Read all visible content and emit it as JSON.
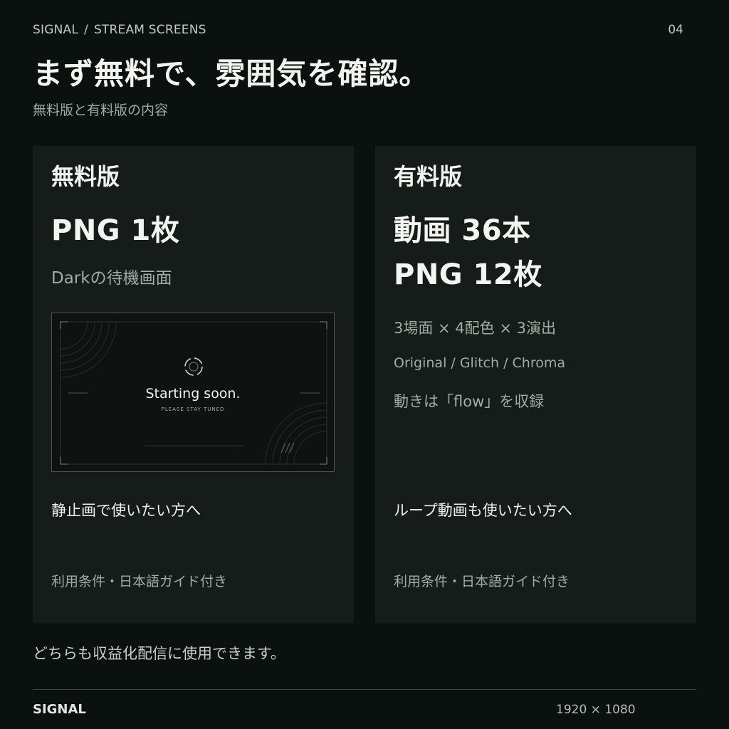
{
  "header": {
    "brand": "SIGNAL",
    "separator": "/",
    "section": "STREAM SCREENS",
    "page_number": "04"
  },
  "title": "まず無料で、雰囲気を確認。",
  "subtitle": "無料版と有料版の内容",
  "free_plan": {
    "name": "無料版",
    "headline": "PNG 1枚",
    "description": "Darkの待機画面",
    "preview": {
      "title": "Starting soon.",
      "subtitle": "PLEASE STAY TUNED"
    },
    "audience": "静止画で使いたい方へ",
    "guide": "利用条件・日本語ガイド付き"
  },
  "paid_plan": {
    "name": "有料版",
    "headline_1": "動画 36本",
    "headline_2": "PNG 12枚",
    "detail_1": "3場面 × 4配色 × 3演出",
    "detail_2": "Original / Glitch / Chroma",
    "detail_3": "動きは「flow」を収録",
    "audience": "ループ動画も使いたい方へ",
    "guide": "利用条件・日本語ガイド付き"
  },
  "note": "どちらも収益化配信に使用できます。",
  "footer": {
    "brand": "SIGNAL",
    "resolution": "1920 × 1080"
  },
  "colors": {
    "background": "#0b110f",
    "card": "#151c19",
    "text": "#ecefe9",
    "muted": "#a3aba4"
  }
}
